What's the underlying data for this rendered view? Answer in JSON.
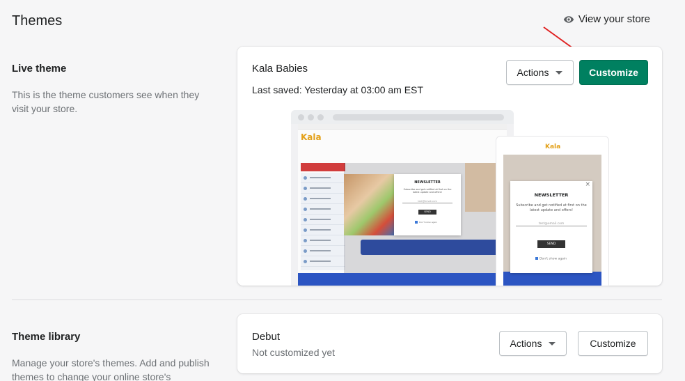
{
  "header": {
    "title": "Themes",
    "view_store_label": "View your store",
    "view_store_icon": "eye-icon"
  },
  "live_theme": {
    "section_title": "Live theme",
    "section_description": "This is the theme customers see when they visit your store.",
    "theme_name": "Kala Babies",
    "last_saved": "Last saved: Yesterday at 03:00 am EST",
    "actions_label": "Actions",
    "customize_label": "Customize",
    "preview": {
      "desktop_logo": "Kala",
      "mobile_logo": "Kala",
      "popup_title": "NEWSLETTER",
      "popup_text": "Subscribe and get notified at first on the latest update and offers!",
      "popup_field_placeholder": "test@email.com",
      "popup_button": "SEND",
      "popup_checkbox": "Don't show again",
      "popup_close": "×"
    }
  },
  "theme_library": {
    "section_title": "Theme library",
    "section_description": "Manage your store's themes. Add and publish themes to change your online store's",
    "theme_name": "Debut",
    "status": "Not customized yet",
    "actions_label": "Actions",
    "customize_label": "Customize"
  },
  "colors": {
    "primary": "#008060",
    "annotation_arrow": "#e02020"
  }
}
